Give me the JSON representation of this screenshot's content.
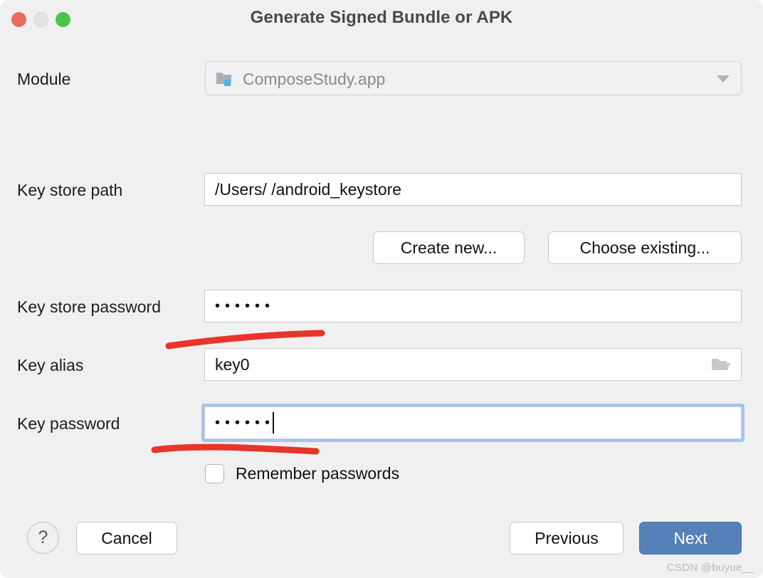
{
  "window": {
    "title": "Generate Signed Bundle or APK",
    "traffic_lights": [
      {
        "name": "close",
        "color": "#ec6a5e"
      },
      {
        "name": "minimize",
        "color": "#e3e3e3"
      },
      {
        "name": "zoom",
        "color": "#4cc449"
      }
    ]
  },
  "form": {
    "module": {
      "label": "Module",
      "value": "ComposeStudy.app",
      "icon": "folder-module-icon",
      "dropdown_icon": "chevron-down-icon"
    },
    "key_store_path": {
      "label": "Key store path",
      "value": "/Users/                /android_keystore",
      "value_prefix": "/Users/",
      "value_suffix": "/android_keystore",
      "redacted": true
    },
    "create_new_button": "Create new...",
    "choose_existing_button": "Choose existing...",
    "key_store_password": {
      "label": "Key store password",
      "value": "••••••",
      "masked_length": 6
    },
    "key_alias": {
      "label": "Key alias",
      "value": "key0",
      "browse_icon": "open-folder-icon"
    },
    "key_password": {
      "label": "Key password",
      "value": "••••••",
      "masked_length": 6,
      "focused": true,
      "focus_ring_color": "#a6c4e8"
    },
    "remember_passwords": {
      "label": "Remember passwords",
      "checked": false
    }
  },
  "footer": {
    "help_button": "?",
    "cancel_button": "Cancel",
    "previous_button": "Previous",
    "next_button": "Next",
    "next_button_color": "#5580b8"
  },
  "annotations": {
    "stroke_color": "#e8342a",
    "strokes": [
      {
        "name": "underline-key-alias"
      },
      {
        "name": "underline-key-password"
      }
    ]
  },
  "watermark": "CSDN @buyue__"
}
